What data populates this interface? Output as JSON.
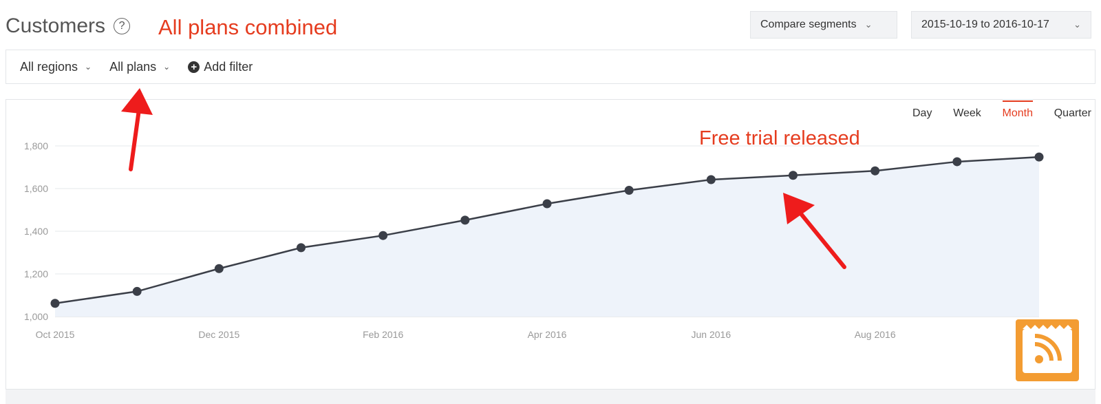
{
  "header": {
    "title": "Customers",
    "help_icon": "question-circle-icon",
    "annotation": "All plans combined"
  },
  "controls": {
    "compare_label": "Compare segments",
    "date_range": "2015-10-19 to 2016-10-17"
  },
  "filters": {
    "regions": "All regions",
    "plans": "All plans",
    "add_filter": "Add filter"
  },
  "periods": [
    "Day",
    "Week",
    "Month",
    "Quarter"
  ],
  "active_period": "Month",
  "colors": {
    "accent": "#e53c1f",
    "line": "#3b3f48",
    "area": "#eef3fa",
    "grid": "#e6e8eb",
    "badge": "#f39c32"
  },
  "annotations": {
    "chart_note": "Free trial released"
  },
  "icons": {
    "dropdown": "chevron-down-icon",
    "add": "plus-circle-icon",
    "badge": "rss-feed-icon",
    "arrows": "red-arrow-icon"
  },
  "chart_data": {
    "type": "line",
    "area_fill": true,
    "title": "",
    "xlabel": "",
    "ylabel": "",
    "x": [
      "Oct 2015",
      "Nov 2015",
      "Dec 2015",
      "Jan 2016",
      "Feb 2016",
      "Mar 2016",
      "Apr 2016",
      "May 2016",
      "Jun 2016",
      "Jul 2016",
      "Aug 2016",
      "Sep 2016",
      "Oct 2016"
    ],
    "x_tick_labels": [
      "Oct 2015",
      "Dec 2015",
      "Feb 2016",
      "Apr 2016",
      "Jun 2016",
      "Aug 2016"
    ],
    "series": [
      {
        "values": [
          1062,
          1118,
          1225,
          1323,
          1380,
          1452,
          1529,
          1592,
          1642,
          1662,
          1683,
          1726,
          1748
        ]
      }
    ],
    "ylim": [
      1000,
      1800
    ],
    "y_ticks": [
      "1,000",
      "1,200",
      "1,400",
      "1,600",
      "1,800"
    ],
    "y_tick_values": [
      1000,
      1200,
      1400,
      1600,
      1800
    ],
    "grid": true,
    "legend": "none"
  }
}
